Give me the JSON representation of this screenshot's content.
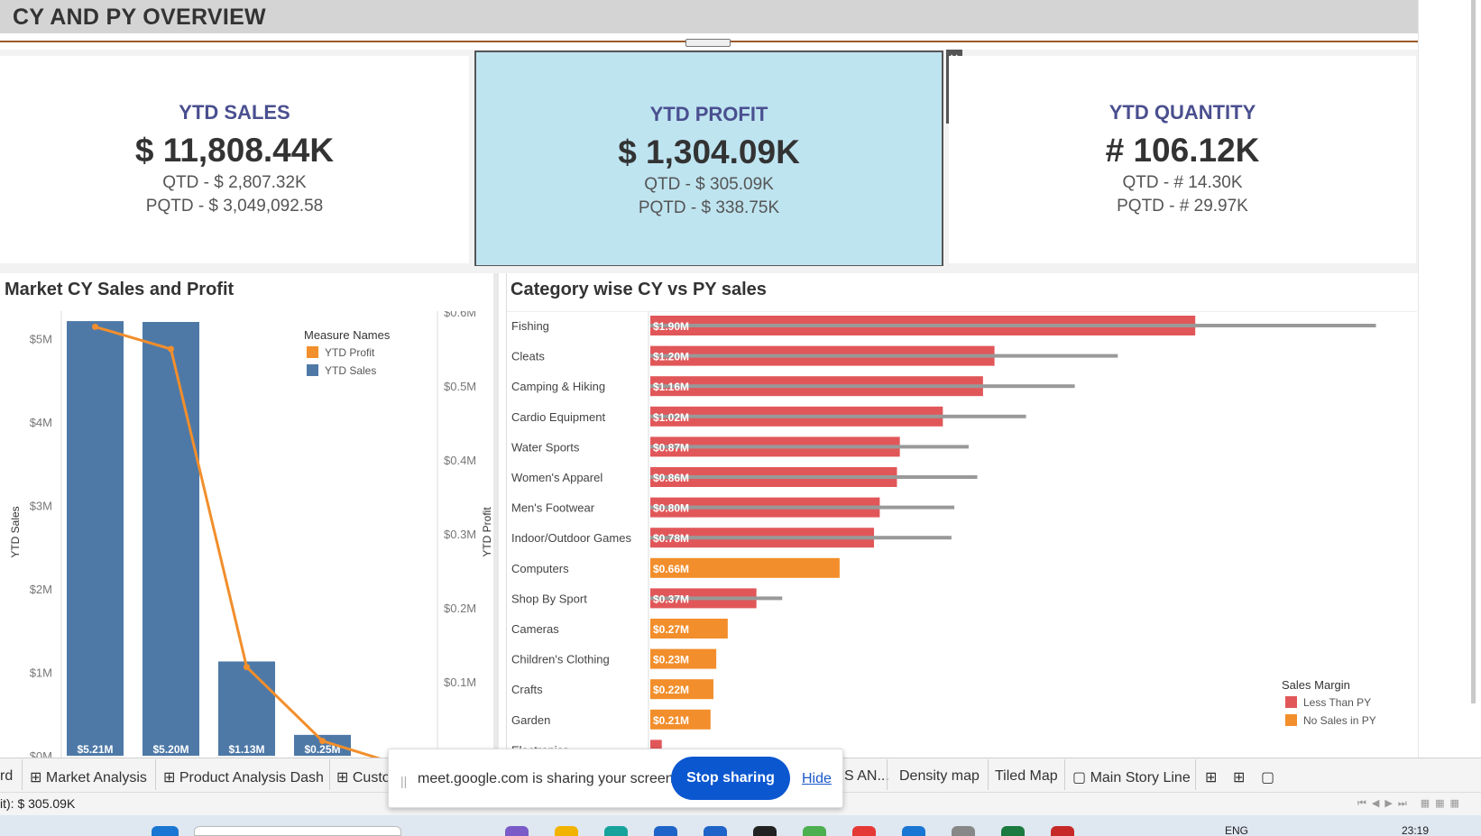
{
  "header": {
    "title": "CY AND PY OVERVIEW"
  },
  "kpis": {
    "sales": {
      "title": "YTD SALES",
      "value": "$ 11,808.44K",
      "qtd": "QTD - $ 2,807.32K",
      "pqtd": "PQTD - $ 3,049,092.58"
    },
    "profit": {
      "title": "YTD PROFIT",
      "value": "$ 1,304.09K",
      "qtd": "QTD - $ 305.09K",
      "pqtd": "PQTD - $ 338.75K"
    },
    "quantity": {
      "title": "YTD QUANTITY",
      "value": "# 106.12K",
      "qtd": "QTD - # 14.30K",
      "pqtd": "PQTD - # 29.97K"
    }
  },
  "market_chart": {
    "title": "Market CY Sales and Profit",
    "legend_title": "Measure Names",
    "legend_items": [
      "YTD Profit",
      "YTD Sales"
    ],
    "colors": {
      "profit": "#f28e2b",
      "sales": "#4e79a7"
    }
  },
  "category_chart": {
    "title": "Category wise CY vs PY sales",
    "legend_title": "Sales Margin",
    "legend_items": [
      "Less Than PY",
      "No Sales in PY"
    ],
    "colors": {
      "less": "#e15759",
      "nosales": "#f28e2b",
      "py": "#999999"
    }
  },
  "chart_data": [
    {
      "type": "bar",
      "title": "Market CY Sales and Profit",
      "ylabel": "YTD Sales",
      "y2label": "YTD Profit",
      "ylim": [
        0,
        5.8
      ],
      "y2lim": [
        0,
        0.62
      ],
      "ticks_y": [
        "$0M",
        "$1M",
        "$2M",
        "$3M",
        "$4M",
        "$5M"
      ],
      "ticks_y2": [
        "$0.1M",
        "$0.2M",
        "$0.3M",
        "$0.4M",
        "$0.5M",
        "$0.6M"
      ],
      "series": [
        {
          "name": "YTD Sales",
          "values": [
            5.21,
            5.2,
            1.13,
            0.25
          ],
          "labels": [
            "$5.21M",
            "$5.20M",
            "$1.13M",
            "$0.25M"
          ]
        },
        {
          "name": "YTD Profit",
          "values": [
            0.58,
            0.55,
            0.12,
            0.02
          ]
        }
      ],
      "legend": "top-right"
    },
    {
      "type": "bar",
      "title": "Category wise CY vs PY sales",
      "orientation": "horizontal",
      "categories": [
        "Fishing",
        "Cleats",
        "Camping & Hiking",
        "Cardio Equipment",
        "Water Sports",
        "Women's Apparel",
        "Men's Footwear",
        "Indoor/Outdoor Games",
        "Computers",
        "Shop By Sport",
        "Cameras",
        "Children's Clothing",
        "Crafts",
        "Garden",
        "Electronics"
      ],
      "series": [
        {
          "name": "CY",
          "values": [
            1.9,
            1.2,
            1.16,
            1.02,
            0.87,
            0.86,
            0.8,
            0.78,
            0.66,
            0.37,
            0.27,
            0.23,
            0.22,
            0.21,
            0.04
          ],
          "labels": [
            "$1.90M",
            "$1.20M",
            "$1.16M",
            "$1.02M",
            "$0.87M",
            "$0.86M",
            "$0.80M",
            "$0.78M",
            "$0.66M",
            "$0.37M",
            "$0.27M",
            "$0.23M",
            "$0.22M",
            "$0.21M",
            ""
          ],
          "margin": [
            "less",
            "less",
            "less",
            "less",
            "less",
            "less",
            "less",
            "less",
            "nosales",
            "less",
            "nosales",
            "nosales",
            "nosales",
            "nosales",
            "less"
          ]
        },
        {
          "name": "PY",
          "values": [
            2.53,
            1.63,
            1.48,
            1.31,
            1.11,
            1.14,
            1.06,
            1.05,
            0,
            0.46,
            0,
            0,
            0,
            0,
            0
          ]
        }
      ],
      "legend": "bottom-right"
    }
  ],
  "tabs": [
    "rd",
    "Market Analysis",
    "Product Analysis Dash",
    "Custo",
    "S AN...",
    "Density map",
    "Tiled Map",
    "Main Story Line"
  ],
  "status": {
    "text": "it): $ 305.09K"
  },
  "share_bar": {
    "message": "meet.google.com is sharing your screen.",
    "stop_label": "Stop sharing",
    "hide_label": "Hide"
  },
  "taskbar": {
    "lang": "ENG",
    "time": "23:19"
  }
}
